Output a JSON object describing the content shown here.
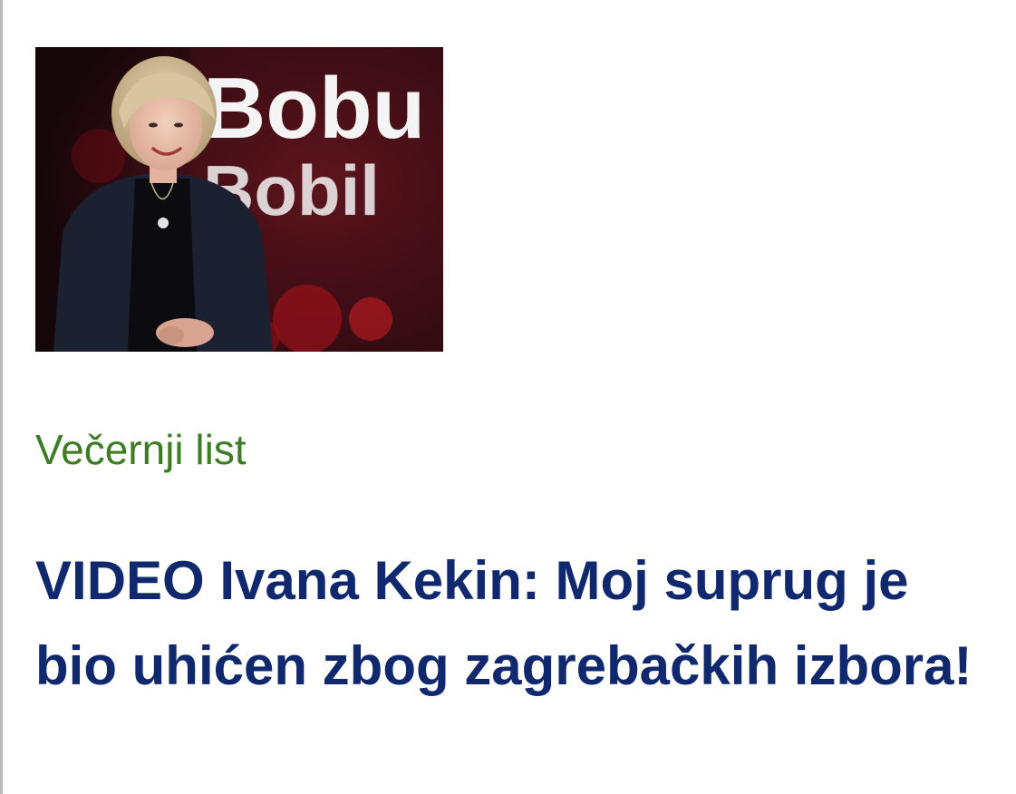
{
  "article": {
    "image": {
      "alt": "Ivana Kekin u TV studiju",
      "backdrop_text": [
        "Bobu",
        "Bobil"
      ]
    },
    "source": "Večernji list",
    "headline": "VIDEO Ivana Kekin: Moj suprug je bio uhićen zbog zagrebačkih izbora!"
  },
  "colors": {
    "source_green": "#3c7d24",
    "headline_navy": "#10286e",
    "border_gray": "#b8b8b8"
  }
}
